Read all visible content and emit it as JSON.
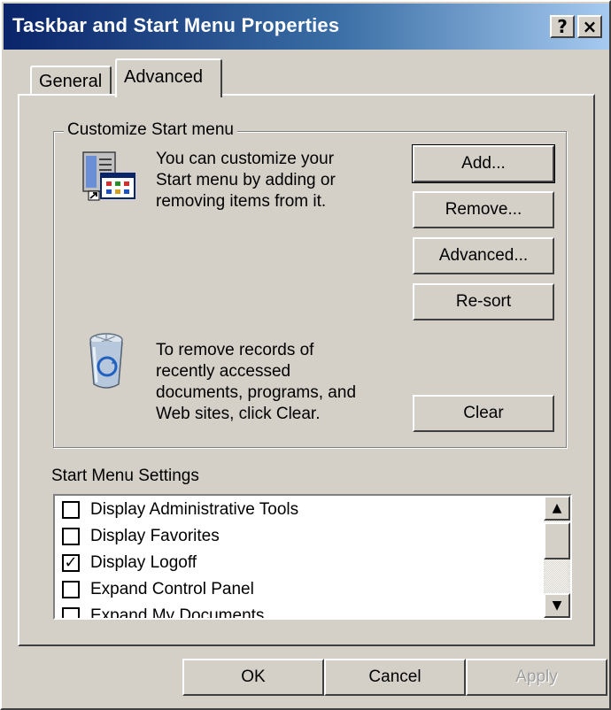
{
  "window": {
    "title": "Taskbar and Start Menu Properties",
    "help_label": "?",
    "close_label": "×"
  },
  "tabs": [
    {
      "label": "General"
    },
    {
      "label": "Advanced"
    }
  ],
  "customize": {
    "legend": "Customize Start menu",
    "description": [
      "You can customize your",
      "Start menu by adding or",
      "removing items from it."
    ],
    "add_label": "Add...",
    "remove_label": "Remove...",
    "advanced_label": "Advanced...",
    "resort_label": "Re-sort",
    "clear_description": [
      "To remove records of",
      "recently accessed",
      "documents, programs, and",
      "Web sites,  click Clear."
    ],
    "clear_label": "Clear"
  },
  "settings": {
    "label": "Start Menu Settings",
    "items": [
      {
        "label": "Display Administrative Tools",
        "check": ""
      },
      {
        "label": "Display Favorites",
        "check": ""
      },
      {
        "label": "Display Logoff",
        "check": "✓"
      },
      {
        "label": "Expand Control Panel",
        "check": ""
      },
      {
        "label": "Expand My Documents",
        "check": ""
      }
    ],
    "scroll_up": "▲",
    "scroll_down": "▼"
  },
  "footer": {
    "ok_label": "OK",
    "cancel_label": "Cancel",
    "apply_label": "Apply"
  }
}
